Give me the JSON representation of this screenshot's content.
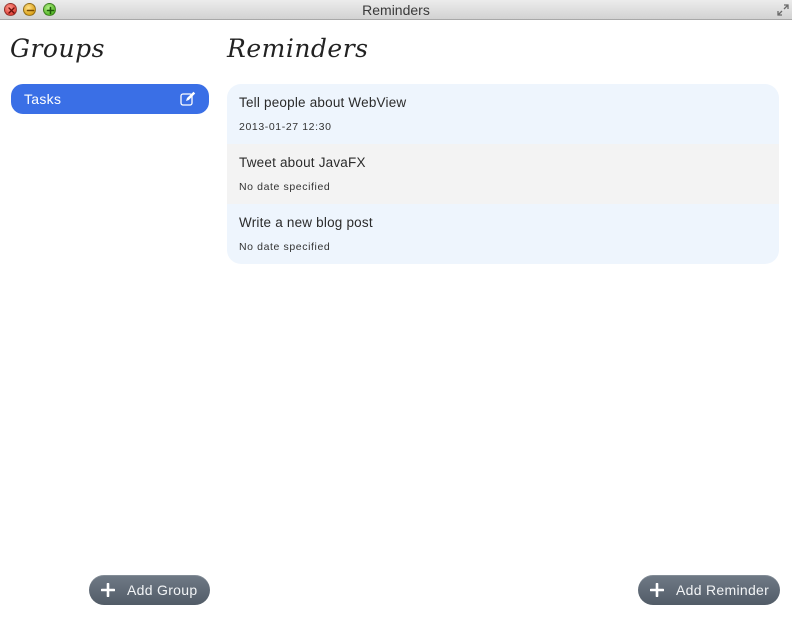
{
  "window": {
    "title": "Reminders"
  },
  "sidebar": {
    "heading": "Groups",
    "groups": [
      {
        "label": "Tasks",
        "selected": true,
        "icon": "edit-icon"
      }
    ],
    "add_button_label": "Add Group"
  },
  "main": {
    "heading": "Reminders",
    "reminders": [
      {
        "title": "Tell people about WebView",
        "date": "2013-01-27 12:30"
      },
      {
        "title": "Tweet about JavaFX",
        "date": "No date specified"
      },
      {
        "title": "Write a new blog post",
        "date": "No date specified"
      }
    ],
    "add_button_label": "Add Reminder"
  },
  "colors": {
    "selection": "#3a6fe6",
    "row_odd": "#eef5fd",
    "row_even": "#f3f3f3",
    "button": "#5f6975"
  },
  "icons": {
    "close": "close-icon",
    "minimize": "minimize-icon",
    "maximize": "maximize-icon",
    "fullscreen": "fullscreen-icon",
    "add": "plus-icon"
  }
}
